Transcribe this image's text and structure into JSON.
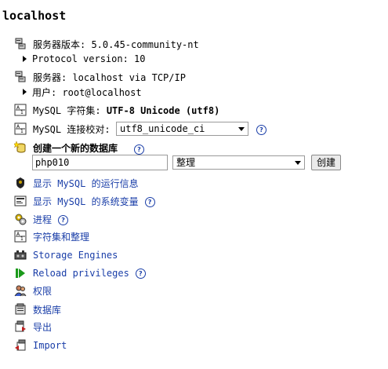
{
  "header": {
    "title": "localhost"
  },
  "server_info": {
    "server_version_label": "服务器版本: 5.0.45-community-nt",
    "protocol_version_label": "Protocol version: 10",
    "server_label": "服务器: localhost via TCP/IP",
    "user_label": "用户: root@localhost"
  },
  "charset": {
    "label_prefix": "MySQL 字符集: ",
    "value": "UTF-8 Unicode (utf8)"
  },
  "collation": {
    "label": "MySQL 连接校对:",
    "selected": "utf8_unicode_ci",
    "help": "?"
  },
  "create_db": {
    "label": "创建一个新的数据库",
    "help": "?",
    "db_name_value": "php010",
    "collation_selected": "整理",
    "create_button": "创建"
  },
  "links": {
    "runtime_info": "显示 MySQL 的运行信息",
    "system_vars": "显示 MySQL 的系统变量",
    "processes": "进程",
    "charsets": "字符集和整理",
    "storage_engines": "Storage Engines",
    "reload_privileges": "Reload privileges",
    "privileges": "权限",
    "databases": "数据库",
    "export": "导出",
    "import": "Import",
    "help": "?"
  }
}
